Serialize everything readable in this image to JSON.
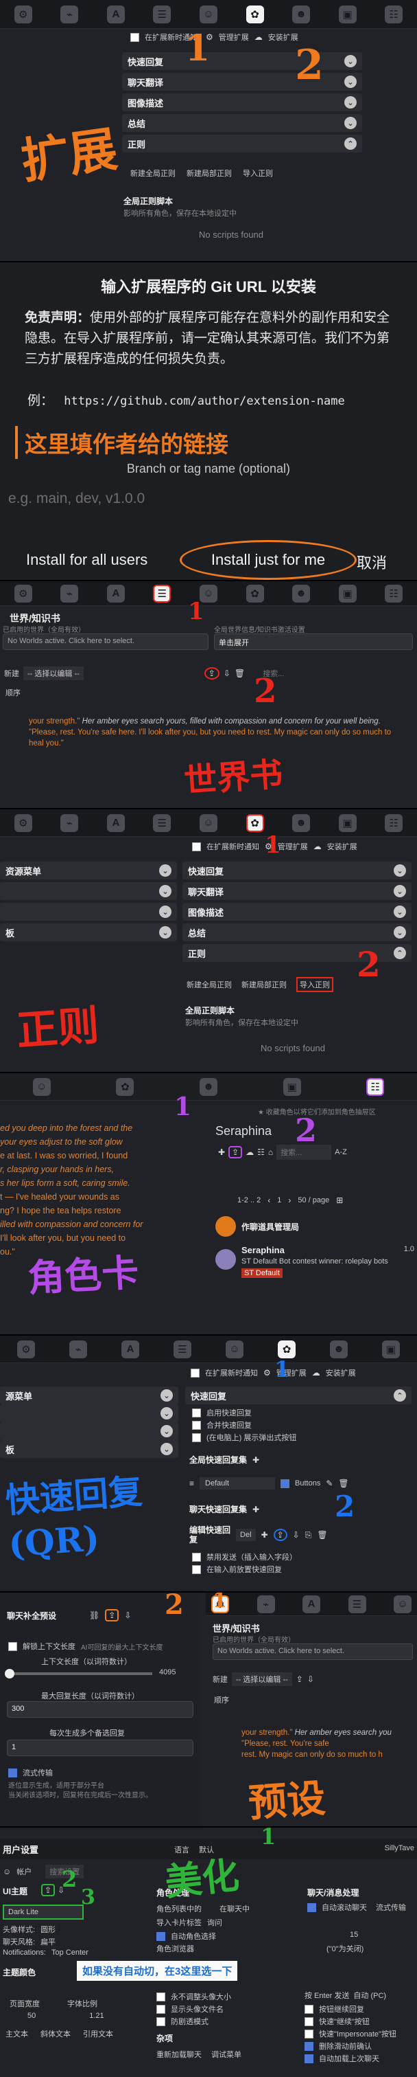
{
  "s1": {
    "notify_label": "在扩展新时通知",
    "manage_label": "管理扩展",
    "install_label": "安装扩展",
    "drawers": [
      "快速回复",
      "聊天翻译",
      "图像描述",
      "总结",
      "正则"
    ],
    "new_global": "新建全局正则",
    "new_local": "新建局部正则",
    "import": "导入正则",
    "global_title": "全局正则脚本",
    "global_desc": "影响所有角色，保存在本地设定中",
    "no_scripts": "No scripts found",
    "ann_extension": "扩展"
  },
  "s2": {
    "heading": "输入扩展程序的 Git URL 以安装",
    "disclaimer_label": "免责声明：",
    "disclaimer": "使用外部的扩展程序可能存在意料外的副作用和安全隐患。在导入扩展程序前，请一定确认其来源可信。我们不为第三方扩展程序造成的任何损失负责。",
    "example_label": "例：",
    "example_url": "https://github.com/author/extension-name",
    "ann_link": "这里填作者给的链接",
    "branch_label": "Branch or tag name (optional)",
    "branch_placeholder": "e.g. main, dev, v1.0.0",
    "install_all": "Install for all users",
    "install_me": "Install just for me",
    "cancel": "取消"
  },
  "s3": {
    "title": "世界/知识书",
    "active_label": "已启用的世界（全局有效）",
    "active_placeholder": "No Worlds active. Click here to select.",
    "global_label": "全局世界信息/知识书激活设置",
    "expand": "单击展开",
    "new_label": "新建",
    "select_placeholder": "-- 选择以编辑 --",
    "search_placeholder": "搜索...",
    "sort_label": "顺序",
    "text_a": "your strength.\"",
    "text_b": " Her amber eyes search yours, filled with compassion and concern for your well being. ",
    "text_c": "\"Please, rest. You're safe here. I'll look after you, but you need to rest. My magic can only do so much to heal you.\"",
    "ann_world": "世界书"
  },
  "s4": {
    "notify_label": "在扩展新时通知",
    "manage_label": "管理扩展",
    "install_label": "安装扩展",
    "left_items": [
      "资源菜单",
      "",
      "",
      "板"
    ],
    "drawers": [
      "快速回复",
      "聊天翻译",
      "图像描述",
      "总结",
      "正则"
    ],
    "new_global": "新建全局正则",
    "new_local": "新建局部正则",
    "import": "导入正则",
    "global_title": "全局正则脚本",
    "global_desc": "影响所有角色，保存在本地设定中",
    "no_scripts": "No scripts found",
    "ann_regex": "正则"
  },
  "s5": {
    "story_lines": [
      "ed you deep into the forest and the",
      "your eyes adjust to the soft glow",
      "e at last. I was so worried, I found",
      "r, clasping your hands in hers,",
      "s her lips form a soft, caring smile.",
      "t — I've healed your wounds as",
      "ng? I hope the tea helps restore",
      "illed with compassion and concern for",
      "I'll look after you, but you need to",
      "ou.\""
    ],
    "fav_label": "收藏角色以将它们添加到角色抽屉区",
    "char_name": "Seraphina",
    "search_placeholder": "搜索...",
    "sort_label": "A-Z",
    "pagination": "1-2 .. 2",
    "page": "1",
    "per_page": "50 / page",
    "folder_title": "作聊道具管理局",
    "card_name": "Seraphina",
    "card_desc": "ST Default Bot contest winner: roleplay bots",
    "card_tag": "ST Default",
    "card_version": "1.0",
    "ann_char": "角色卡"
  },
  "s6": {
    "notify_label": "在扩展新时通知",
    "manage_label": "管理扩展",
    "install_label": "安装扩展",
    "left_items": [
      "源菜单",
      "",
      "",
      "板"
    ],
    "qr_title": "快速回复",
    "qr_enable": "启用快速回复",
    "qr_merge": "合并快速回复",
    "qr_show": "(在电脑上) 展示弹出式按钮",
    "global_sets": "全局快速回复集",
    "default_set": "Default",
    "buttons_label": "Buttons",
    "chat_sets": "聊天快速回复集",
    "edit_label": "编辑快速回",
    "edit_label2": "复",
    "del_label": "Del",
    "disable_send": "禁用发送（插入输入字段）",
    "cursor_place": "在输入前放置快速回复",
    "ann_qr": "快速回复(QR)"
  },
  "s7": {
    "left_header": "聊天补全预设",
    "unlock": "解锁上下文长度",
    "unlock_hint": "AI可回复的最大上下文长度",
    "context_label": "上下文长度（以词符数计）",
    "context_value": "4095",
    "max_reply_label": "最大回复长度（以词符数计）",
    "max_reply_value": "300",
    "gen_count_label": "每次生成多个备选回复",
    "gen_count_value": "1",
    "stream_label": "流式传输",
    "stream_hint": "逐位显示生成，适用于部分平台",
    "stream_hint2": "当关闭该选项时，回复将在完成后一次性显示。",
    "right_title": "世界/知识书",
    "active_label": "已启用的世界（全局有效）",
    "active_placeholder": "No Worlds active. Click here to select.",
    "new_label": "新建",
    "select_placeholder": "-- 选择以编辑 --",
    "sort_label": "顺序",
    "text_a": "your strength.\"",
    "text_b": " Her amber eyes search you",
    "text_c": "\"Please, rest. You're safe",
    "text_d": "rest. My magic can only do so much to h",
    "ann_preset": "预设"
  },
  "s8": {
    "user_settings": "用户设置",
    "language_label": "语言",
    "language_value": "默认",
    "sillytavern": "SillyTave",
    "account_label": "帐户",
    "search_placeholder": "搜索设置",
    "ui_theme": "UI主题",
    "theme_value": "Dark Lite",
    "avatar_style": "头像样式:",
    "avatar_value": "圆形",
    "chat_style": "聊天风格:",
    "chat_style_value": "扁平",
    "notifications": "Notifications:",
    "notifications_value": "Top Center",
    "theme_color": "主题颜色",
    "page_width": "页面宽度",
    "font_scale": "字体比例",
    "page_width_value": "50",
    "font_scale_value": "1.21",
    "main_text": "主文本",
    "italic_text": "斜体文本",
    "quote_text": "引用文本",
    "char_handling": "角色处理",
    "char_list_items": "角色列表中的",
    "in_chat_label": "在聊天中",
    "import_tags": "导入卡片标签",
    "import_tags_value": "询问",
    "auto_switch": "自动角色选择",
    "char_browse": "角色浏览器",
    "never_resize": "永不调整头像大小",
    "show_card_name": "显示头像文件名",
    "spoiler_free": "防剧透模式",
    "misc": "杂项",
    "reload": "重新加载聊天",
    "debug": "调试菜单",
    "chat_msg": "聊天/消息处理",
    "auto_scroll": "自动滚动聊天",
    "stream_fps": "流式传输",
    "fps_value": "15",
    "fps_hint": "(\"0\"为关闭)",
    "enter_send": "按 Enter 发送",
    "enter_value": "自动 (PC)",
    "continue_btn": "按钮继续回复",
    "quick_continue": "快速\"继续\"按钮",
    "quick_swipe": "快速\"Impersonate\"按钮",
    "delete_swipe": "删除滑动前确认",
    "auto_load": "自动加载上次聊天",
    "tip_text": "如果没有自动切，在3这里选一下",
    "ann_beautify": "美化"
  }
}
